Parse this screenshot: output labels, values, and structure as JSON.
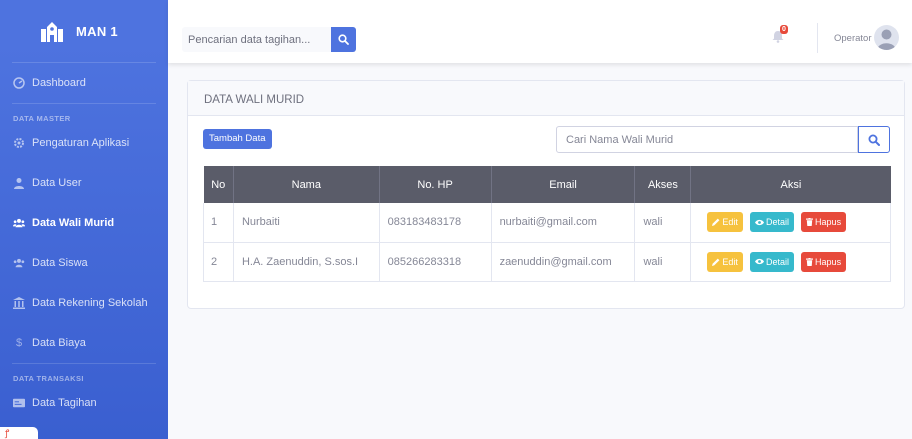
{
  "brand": {
    "name": "MAN 1"
  },
  "sidebar": {
    "items": [
      {
        "label": "Dashboard"
      },
      {
        "label": "Pengaturan Aplikasi"
      },
      {
        "label": "Data User"
      },
      {
        "label": "Data Wali Murid"
      },
      {
        "label": "Data Siswa"
      },
      {
        "label": "Data Rekening Sekolah"
      },
      {
        "label": "Data Biaya"
      },
      {
        "label": "Data Tagihan"
      }
    ],
    "headings": {
      "master": "DATA MASTER",
      "transaksi": "DATA TRANSAKSI"
    }
  },
  "topbar": {
    "search_placeholder": "Pencarian data tagihan...",
    "alert_count": "0",
    "user_name": "Operator"
  },
  "card": {
    "title": "DATA WALI MURID",
    "add_label": "Tambah Data",
    "search_placeholder": "Cari Nama Wali Murid"
  },
  "table": {
    "headers": [
      "No",
      "Nama",
      "No. HP",
      "Email",
      "Akses",
      "Aksi"
    ],
    "rows": [
      {
        "no": "1",
        "nama": "Nurbaiti",
        "hp": "083183483178",
        "email": "nurbaiti@gmail.com",
        "akses": "wali"
      },
      {
        "no": "2",
        "nama": "H.A. Zaenuddin, S.sos.I",
        "hp": "085266283318",
        "email": "zaenuddin@gmail.com",
        "akses": "wali"
      }
    ],
    "actions": {
      "edit": "Edit",
      "detail": "Detail",
      "hapus": "Hapus"
    }
  },
  "colors": {
    "primary": "#4e73df",
    "warning": "#f6c23e",
    "info": "#36b9cc",
    "danger": "#e74a3b",
    "table_head": "#5a5c69"
  }
}
